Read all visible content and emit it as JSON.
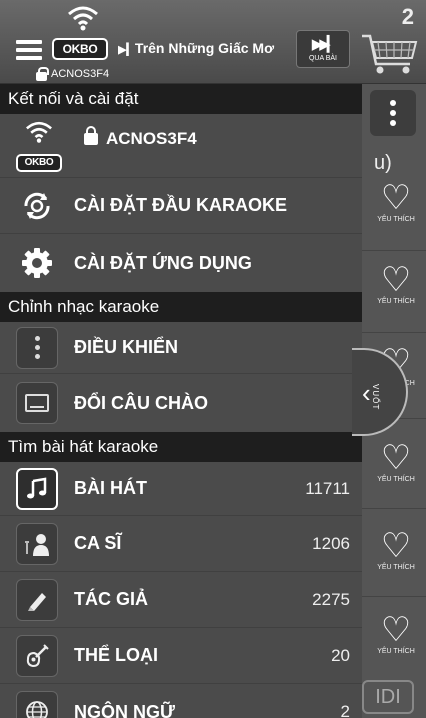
{
  "topbar": {
    "now_playing": "Trên Những Giấc Mơ",
    "skip_label": "QUA BÀI",
    "network_name": "ACNOS3F4",
    "logo_text": "OKBO",
    "queue_count": "2"
  },
  "drawer": {
    "sections": {
      "connect": "Kết nối và cài đặt",
      "control": "Chỉnh nhạc karaoke",
      "search": "Tìm bài hát karaoke"
    },
    "connection": {
      "network": "ACNOS3F4",
      "logo_text": "OKBO"
    },
    "settings_player": "CÀI ĐẶT ĐẦU KARAOKE",
    "settings_app": "CÀI ĐẶT ỨNG DỤNG",
    "control": "ĐIỀU KHIỂN",
    "greeting": "ĐỔI CÂU CHÀO",
    "songs": {
      "label": "BÀI HÁT",
      "count": "11711"
    },
    "singers": {
      "label": "CA SĨ",
      "count": "1206"
    },
    "composers": {
      "label": "TÁC GIẢ",
      "count": "2275"
    },
    "genres": {
      "label": "THỂ LOẠI",
      "count": "20"
    },
    "languages": {
      "label": "NGÔN NGỮ",
      "count": "2"
    }
  },
  "background": {
    "favorite_label": "YÊU THÍCH",
    "partial_text": "u)",
    "swipe_label": "VUỐT",
    "idi_label": "IDI"
  },
  "icons": {
    "menu": "hamburger-icon",
    "wifi": "wifi-icon",
    "lock": "lock-icon",
    "skip": "skip-forward-icon",
    "cart": "cart-icon",
    "player_settings": "sync-settings-icon",
    "app_settings": "gear-icon",
    "control": "vertical-dots-icon",
    "greeting": "tv-icon",
    "songs": "music-note-icon",
    "singers": "singer-icon",
    "composers": "pen-icon",
    "genres": "guitar-icon",
    "languages": "globe-icon",
    "favorite": "heart-icon"
  }
}
